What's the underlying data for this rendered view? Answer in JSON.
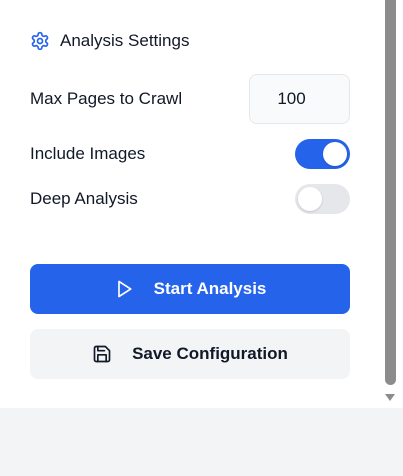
{
  "header": {
    "title": "Analysis Settings",
    "icon": "gear-icon",
    "icon_color": "#2563eb"
  },
  "settings": {
    "max_pages_label": "Max Pages to Crawl",
    "max_pages_value": "100",
    "include_images_label": "Include Images",
    "include_images_enabled": true,
    "deep_analysis_label": "Deep Analysis",
    "deep_analysis_enabled": false
  },
  "actions": {
    "start_label": "Start Analysis",
    "start_icon": "play-icon",
    "save_label": "Save Configuration",
    "save_icon": "save-icon"
  },
  "colors": {
    "accent": "#2563eb",
    "toggle_off": "#e5e7eb",
    "secondary_button": "#f3f4f6"
  }
}
